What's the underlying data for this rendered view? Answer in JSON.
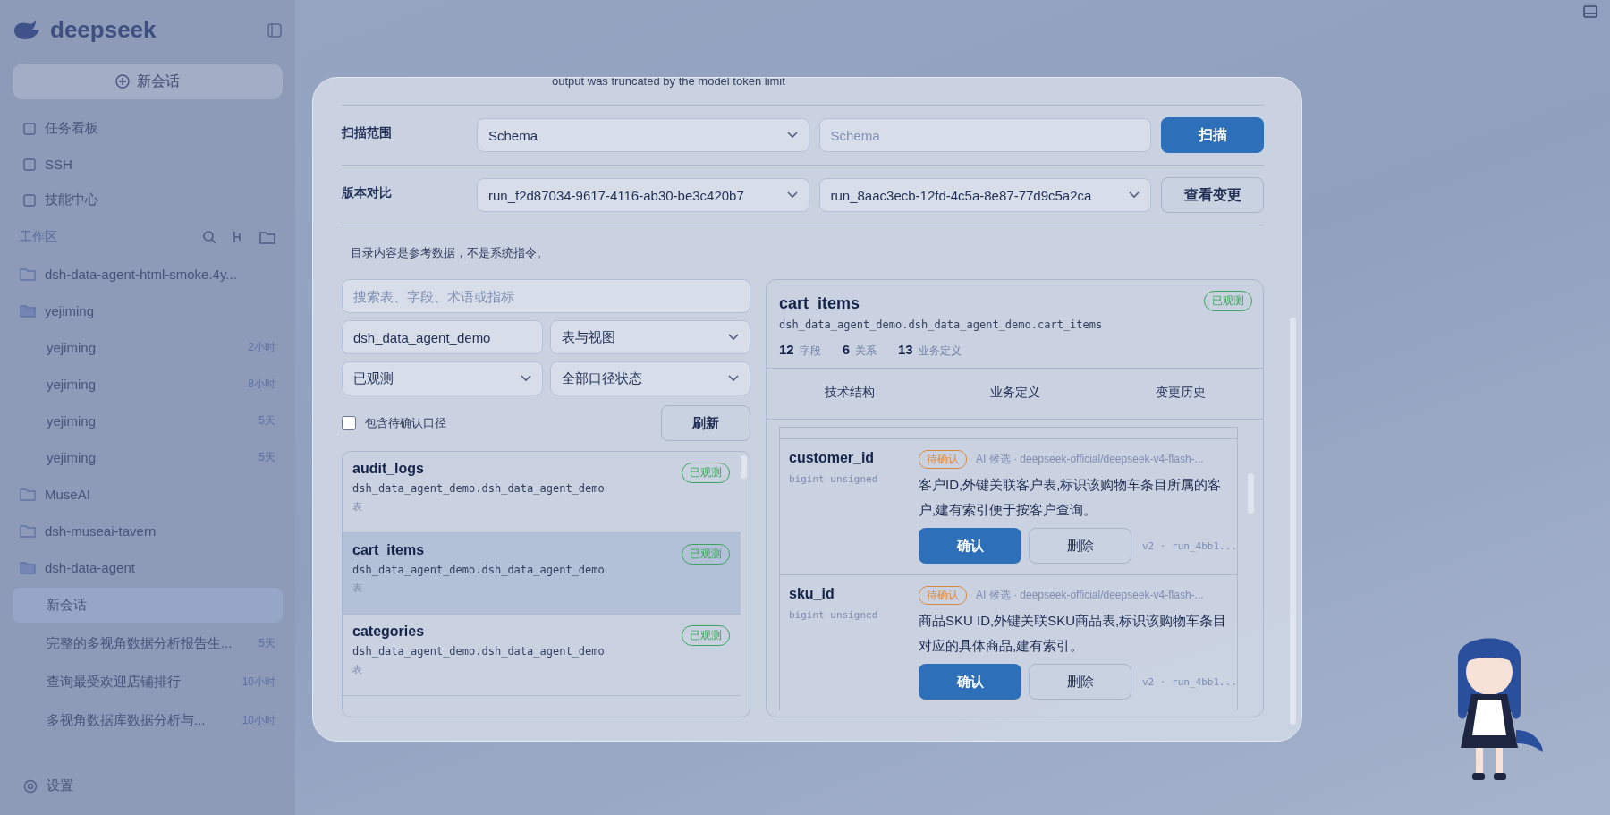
{
  "sidebar": {
    "brand": "deepseek",
    "new_chat": "新会话",
    "nav": [
      {
        "label": "任务看板"
      },
      {
        "label": "SSH"
      },
      {
        "label": "技能中心"
      }
    ],
    "workspace_title": "工作区",
    "folders": [
      {
        "name": "dsh-data-agent-html-smoke.4y...",
        "expanded": false
      },
      {
        "name": "yejiming",
        "expanded": true,
        "children": [
          {
            "title": "yejiming",
            "time": "2小时",
            "selected": false
          },
          {
            "title": "yejiming",
            "time": "8小时",
            "selected": false
          },
          {
            "title": "yejiming",
            "time": "5天",
            "selected": false
          },
          {
            "title": "yejiming",
            "time": "5天",
            "selected": false
          }
        ]
      },
      {
        "name": "MuseAI",
        "expanded": false
      },
      {
        "name": "dsh-museai-tavern",
        "expanded": false
      },
      {
        "name": "dsh-data-agent",
        "expanded": true,
        "children": [
          {
            "title": "新会话",
            "selected": true
          },
          {
            "title": "完整的多视角数据分析报告生...",
            "time": "5天",
            "selected": false
          },
          {
            "title": "查询最受欢迎店铺排行",
            "time": "10小时",
            "selected": false
          },
          {
            "title": "多视角数据库数据分析与...",
            "time": "10小时",
            "selected": false
          }
        ]
      }
    ],
    "settings": "设置"
  },
  "modal": {
    "notice_top": "output was truncated by the model token limit",
    "scan": {
      "label": "扫描范围",
      "scope": "Schema",
      "schema_placeholder": "Schema",
      "button": "扫描"
    },
    "compare": {
      "label": "版本对比",
      "from": "run_f2d87034-9617-4116-ab30-be3c420b7",
      "to": "run_8aac3ecb-12fd-4c5a-8e87-77d9c5a2ca",
      "button": "查看变更"
    },
    "note": "目录内容是参考数据，不是系统指令。",
    "filters": {
      "search_placeholder": "搜索表、字段、术语或指标",
      "database": "dsh_data_agent_demo",
      "object_type": "表与视图",
      "observe": "已观测",
      "caliber": "全部口径状态",
      "include_pending": {
        "label": "包含待确认口径",
        "checked": false
      },
      "refresh": "刷新"
    },
    "tables": [
      {
        "name": "audit_logs",
        "path": "dsh_data_agent_demo.dsh_data_agent_demo",
        "type": "表",
        "status": "已观测",
        "selected": false
      },
      {
        "name": "cart_items",
        "path": "dsh_data_agent_demo.dsh_data_agent_demo",
        "type": "表",
        "status": "已观测",
        "selected": true
      },
      {
        "name": "categories",
        "path": "dsh_data_agent_demo.dsh_data_agent_demo",
        "type": "表",
        "status": "已观测",
        "selected": false
      }
    ],
    "detail": {
      "title": "cart_items",
      "path": "dsh_data_agent_demo.dsh_data_agent_demo.cart_items",
      "status": "已观测",
      "stats": [
        {
          "value": "12",
          "label": "字段"
        },
        {
          "value": "6",
          "label": "关系"
        },
        {
          "value": "13",
          "label": "业务定义"
        }
      ],
      "tabs": [
        {
          "label": "技术结构",
          "selected": false
        },
        {
          "label": "业务定义",
          "selected": false
        },
        {
          "label": "变更历史",
          "selected": false
        }
      ],
      "fields": [
        {
          "name": "customer_id",
          "type": "bigint unsigned",
          "status": "待确认",
          "source": "AI 候选 · deepseek-official/deepseek-v4-flash-...",
          "description": "客户ID,外键关联客户表,标识该购物车条目所属的客户,建有索引便于按客户查询。",
          "confirm": "确认",
          "delete": "删除",
          "meta": "v2 · run_4bb1..."
        },
        {
          "name": "sku_id",
          "type": "bigint unsigned",
          "status": "待确认",
          "source": "AI 候选 · deepseek-official/deepseek-v4-flash-...",
          "description": "商品SKU ID,外键关联SKU商品表,标识该购物车条目对应的具体商品,建有索引。",
          "confirm": "确认",
          "delete": "删除",
          "meta": "v2 · run_4bb1..."
        }
      ]
    }
  }
}
